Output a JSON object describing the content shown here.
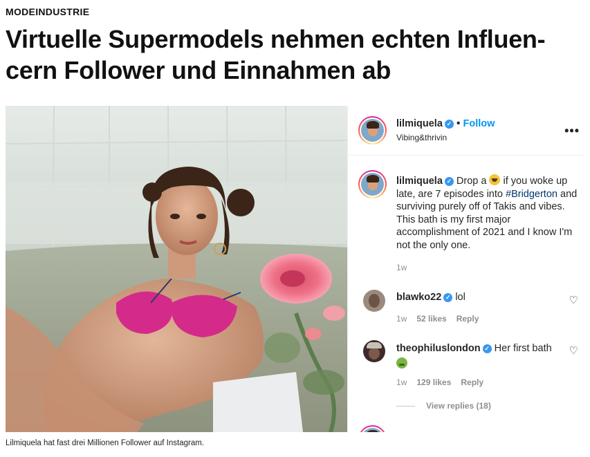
{
  "article": {
    "kicker": "MODEINDUSTRIE",
    "headline": "Virtuelle Supermodels nehmen echten Influen-cern Follower und Einnahmen ab",
    "image_caption": "Lilmiquela hat fast drei Millionen Follower auf Instagram."
  },
  "post": {
    "username": "lilmiquela",
    "verified_mark": "✓",
    "dot": "•",
    "follow_label": "Follow",
    "subtitle": "Vibing&thrivin",
    "more_label": "•••",
    "caption": {
      "username": "lilmiquela",
      "text_before": "Drop a",
      "emoji": "tired-face-emoji",
      "text_mid": "if you woke up late, are 7 episodes into",
      "hashtag": "#Bridgerton",
      "text_after": "and surviving purely off of Takis and vibes. This bath is my first major accomplishment of 2021 and I know I'm not the only one.",
      "time": "1w"
    },
    "comments": [
      {
        "username": "blawko22",
        "text": "lol",
        "time": "1w",
        "likes": "52 likes",
        "reply": "Reply"
      },
      {
        "username": "theophiluslondon",
        "text": "Her first bath",
        "emoji": "nauseated-face-emoji",
        "time": "1w",
        "likes": "129 likes",
        "reply": "Reply"
      }
    ],
    "view_replies": "View replies (18)"
  },
  "colors": {
    "link_blue": "#0095f6",
    "hashtag_blue": "#00376b",
    "verified_blue": "#3897f0",
    "muted_gray": "#8e8e8e"
  }
}
